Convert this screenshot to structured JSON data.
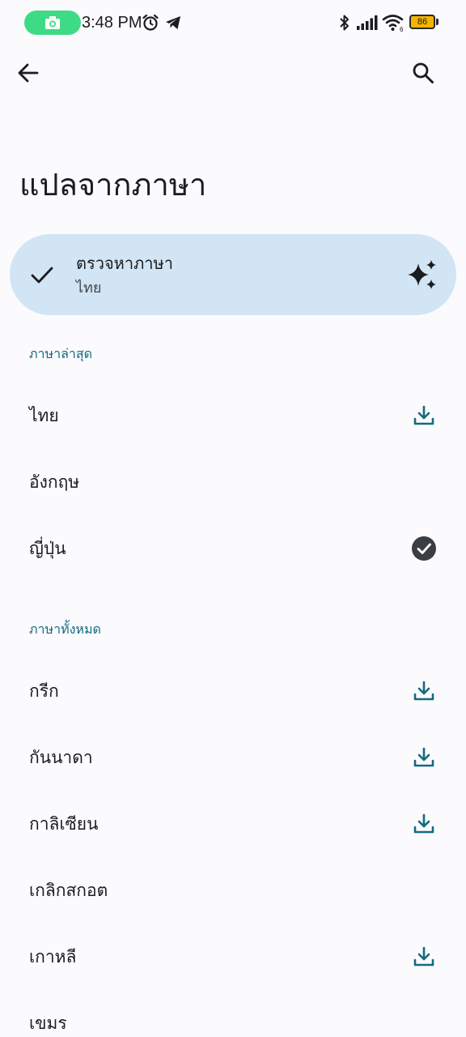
{
  "status_bar": {
    "time": "3:48 PM",
    "battery_level": "86",
    "icons": [
      "camera-icon",
      "alarm-icon",
      "telegram-icon",
      "bluetooth-icon",
      "signal-icon",
      "wifi-icon",
      "battery-icon"
    ]
  },
  "toolbar": {
    "back_icon": "arrow-back-icon",
    "search_icon": "search-icon"
  },
  "page": {
    "title": "แปลจากภาษา"
  },
  "detect": {
    "title": "ตรวจหาภาษา",
    "subtitle": "ไทย",
    "selected": true,
    "icon": "sparkle-icon"
  },
  "recent": {
    "header": "ภาษาล่าสุด",
    "items": [
      {
        "label": "ไทย",
        "action": "download"
      },
      {
        "label": "อังกฤษ",
        "action": "none"
      },
      {
        "label": "ญี่ปุ่น",
        "action": "downloaded"
      }
    ]
  },
  "all": {
    "header": "ภาษาทั้งหมด",
    "items": [
      {
        "label": "กรีก",
        "action": "download"
      },
      {
        "label": "กันนาดา",
        "action": "download"
      },
      {
        "label": "กาลิเซียน",
        "action": "download"
      },
      {
        "label": "เกลิกสกอต",
        "action": "none"
      },
      {
        "label": "เกาหลี",
        "action": "download"
      },
      {
        "label": "เขมร",
        "action": "none"
      }
    ]
  },
  "colors": {
    "background": "#fbfafd",
    "card": "#d1e5f4",
    "accent": "#136b80",
    "camera_pill": "#3ddc84"
  }
}
